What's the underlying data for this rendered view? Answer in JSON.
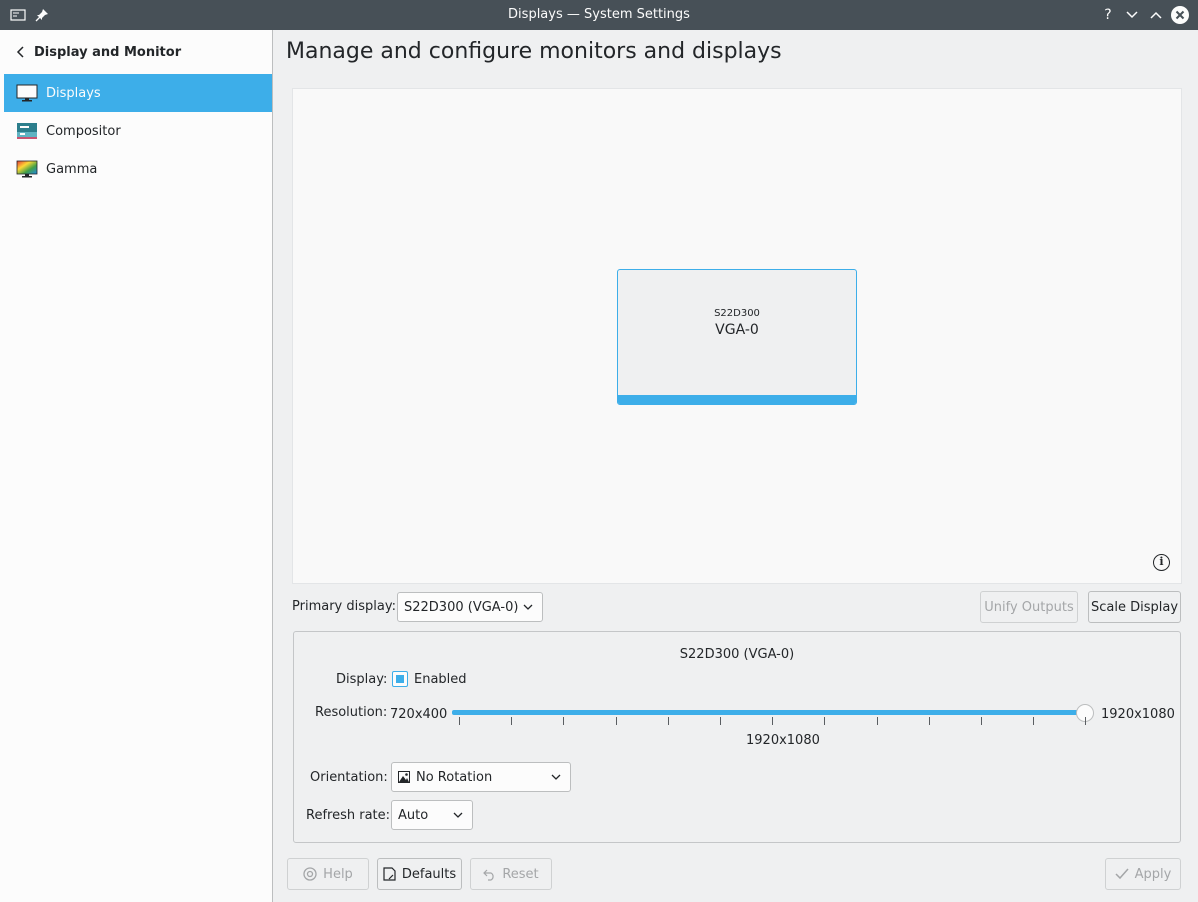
{
  "window": {
    "title": "Displays — System Settings"
  },
  "sidebar": {
    "header": "Display and Monitor",
    "items": [
      {
        "label": "Displays",
        "icon": "monitor-icon",
        "active": true
      },
      {
        "label": "Compositor",
        "icon": "compositor-icon",
        "active": false
      },
      {
        "label": "Gamma",
        "icon": "gamma-icon",
        "active": false
      }
    ]
  },
  "main": {
    "title": "Manage and configure monitors and displays",
    "monitor": {
      "name": "S22D300",
      "output": "VGA-0"
    },
    "primary_display_label": "Primary display:",
    "primary_display_value": "S22D300 (VGA-0)",
    "unify_outputs": "Unify Outputs",
    "scale_display": "Scale Display",
    "output_group": {
      "title": "S22D300 (VGA-0)",
      "display_label": "Display:",
      "enabled_label": "Enabled",
      "enabled": true,
      "resolution_label": "Resolution:",
      "resolution_min": "720x400",
      "resolution_max": "1920x1080",
      "resolution_current": "1920x1080",
      "resolution_fraction": 1.0,
      "orientation_label": "Orientation:",
      "orientation_value": "No Rotation",
      "refresh_label": "Refresh rate:",
      "refresh_value": "Auto"
    },
    "footer": {
      "help": "Help",
      "defaults": "Defaults",
      "reset": "Reset",
      "apply": "Apply"
    }
  },
  "colors": {
    "accent": "#3daee9",
    "titlebar": "#475057"
  }
}
